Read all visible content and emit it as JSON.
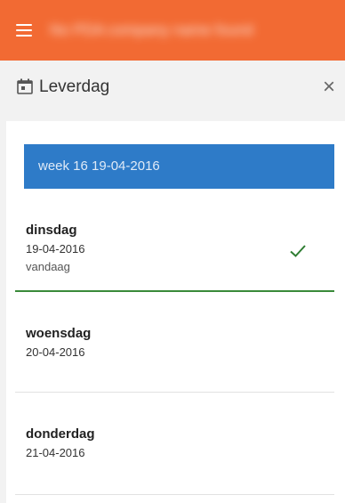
{
  "appbar": {
    "title": "No PDA company name found"
  },
  "dialog": {
    "title": "Leverdag",
    "close_glyph": "×"
  },
  "week": {
    "label": "week 16 19-04-2016"
  },
  "days": [
    {
      "name": "dinsdag",
      "date": "19-04-2016",
      "note": "vandaag",
      "selected": true
    },
    {
      "name": "woensdag",
      "date": "20-04-2016"
    },
    {
      "name": "donderdag",
      "date": "21-04-2016"
    }
  ],
  "colors": {
    "appbar": "#f26a33",
    "week_bar": "#2e7bc8",
    "selected_accent": "#3a8a3a"
  },
  "icons": [
    "menu-icon",
    "calendar-icon",
    "close-icon",
    "checkmark-icon"
  ]
}
